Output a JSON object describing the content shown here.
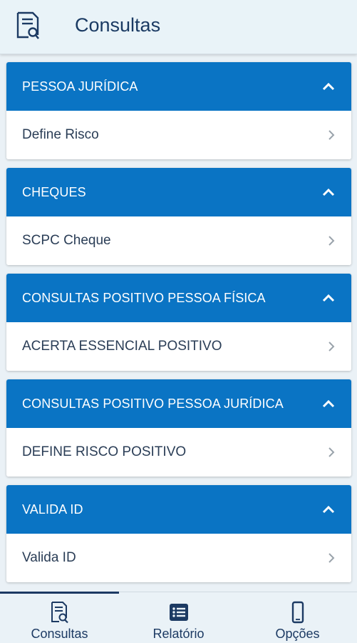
{
  "app_bar": {
    "title": "Consultas",
    "icon": "document-search-icon"
  },
  "sections": [
    {
      "header": "PESSOA JURÍDICA",
      "item": "Define Risco",
      "expanded": true
    },
    {
      "header": "CHEQUES",
      "item": "SCPC Cheque",
      "expanded": true
    },
    {
      "header": "CONSULTAS POSITIVO PESSOA FÍSICA",
      "item": "ACERTA ESSENCIAL POSITIVO",
      "expanded": true
    },
    {
      "header": "CONSULTAS POSITIVO PESSOA JURÍDICA",
      "item": "DEFINE RISCO POSITIVO",
      "expanded": true
    },
    {
      "header": "VALIDA ID",
      "item": "Valida ID",
      "expanded": true
    }
  ],
  "bottom_nav": {
    "items": [
      {
        "label": "Consultas",
        "icon": "document-search-icon",
        "active": true
      },
      {
        "label": "Relatório",
        "icon": "list-icon",
        "active": false
      },
      {
        "label": "Opções",
        "icon": "phone-icon",
        "active": false
      }
    ]
  },
  "colors": {
    "header_blue": "#0a74c4",
    "nav_text": "#1c3a63",
    "background": "#eaf1f6"
  }
}
